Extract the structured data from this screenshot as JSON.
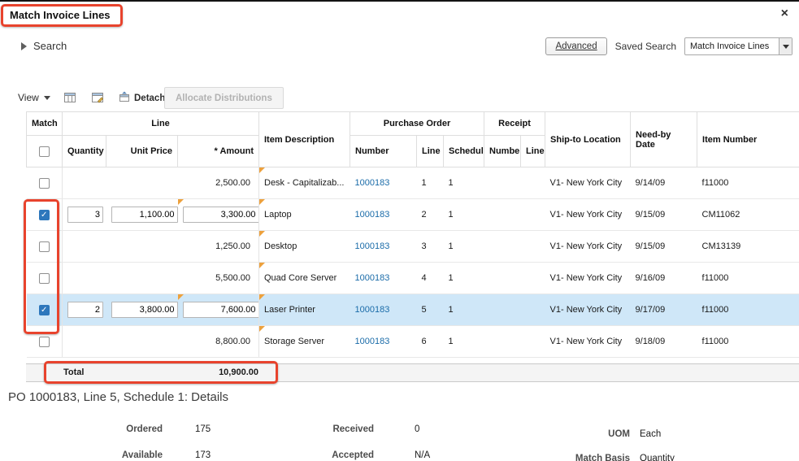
{
  "colors": {
    "annotation": "#e8432d",
    "link": "#1b6ca9",
    "selected_row": "#cfe7f8",
    "marker": "#eda13d",
    "checkbox": "#2d77bc"
  },
  "dialog": {
    "title": "Match Invoice Lines",
    "close_label": "×"
  },
  "search": {
    "label": "Search",
    "advanced_label": "Advanced",
    "saved_search_label": "Saved Search",
    "saved_search_value": "Match Invoice Lines"
  },
  "toolbar": {
    "view_label": "View",
    "detach_label": "Detach",
    "allocate_label": "Allocate Distributions"
  },
  "table": {
    "group_headers": {
      "match": "Match",
      "line": "Line",
      "item_description": "Item Description",
      "purchase_order": "Purchase Order",
      "receipt": "Receipt",
      "ship_to_location": "Ship-to Location",
      "need_by_date": "Need-by Date",
      "item_number": "Item Number"
    },
    "sub_headers": {
      "quantity": "Quantity",
      "unit_price": "Unit Price",
      "amount": "* Amount",
      "po_number": "Number",
      "po_line": "Line",
      "po_schedule": "Schedul",
      "receipt_number": "Numbe",
      "receipt_line": "Line"
    },
    "rows": [
      {
        "checked": false,
        "selected": false,
        "quantity": "",
        "unit_price": "",
        "amount": "2,500.00",
        "description": "Desk - Capitalizab...",
        "po_number": "1000183",
        "po_line": "1",
        "po_schedule": "1",
        "receipt_number": "",
        "receipt_line": "",
        "ship_to_location": "V1- New York City",
        "need_by_date": "9/14/09",
        "item_number": "f11000"
      },
      {
        "checked": true,
        "selected": false,
        "quantity": "3",
        "unit_price": "1,100.00",
        "amount": "3,300.00",
        "description": "Laptop",
        "po_number": "1000183",
        "po_line": "2",
        "po_schedule": "1",
        "receipt_number": "",
        "receipt_line": "",
        "ship_to_location": "V1- New York City",
        "need_by_date": "9/15/09",
        "item_number": "CM11062"
      },
      {
        "checked": false,
        "selected": false,
        "quantity": "",
        "unit_price": "",
        "amount": "1,250.00",
        "description": "Desktop",
        "po_number": "1000183",
        "po_line": "3",
        "po_schedule": "1",
        "receipt_number": "",
        "receipt_line": "",
        "ship_to_location": "V1- New York City",
        "need_by_date": "9/15/09",
        "item_number": "CM13139"
      },
      {
        "checked": false,
        "selected": false,
        "quantity": "",
        "unit_price": "",
        "amount": "5,500.00",
        "description": "Quad Core Server",
        "po_number": "1000183",
        "po_line": "4",
        "po_schedule": "1",
        "receipt_number": "",
        "receipt_line": "",
        "ship_to_location": "V1- New York City",
        "need_by_date": "9/16/09",
        "item_number": "f11000"
      },
      {
        "checked": true,
        "selected": true,
        "quantity": "2",
        "unit_price": "3,800.00",
        "amount": "7,600.00",
        "description": "Laser Printer",
        "po_number": "1000183",
        "po_line": "5",
        "po_schedule": "1",
        "receipt_number": "",
        "receipt_line": "",
        "ship_to_location": "V1- New York City",
        "need_by_date": "9/17/09",
        "item_number": "f11000"
      },
      {
        "checked": false,
        "selected": false,
        "quantity": "",
        "unit_price": "",
        "amount": "8,800.00",
        "description": "Storage Server",
        "po_number": "1000183",
        "po_line": "6",
        "po_schedule": "1",
        "receipt_number": "",
        "receipt_line": "",
        "ship_to_location": "V1- New York City",
        "need_by_date": "9/18/09",
        "item_number": "f11000"
      }
    ],
    "total_label": "Total",
    "total_value": "10,900.00"
  },
  "details": {
    "title": "PO 1000183, Line 5, Schedule 1: Details",
    "columns": [
      {
        "fields": [
          {
            "label": "Ordered",
            "value": "175"
          },
          {
            "label": "Available",
            "value": "173"
          }
        ]
      },
      {
        "fields": [
          {
            "label": "Received",
            "value": "0"
          },
          {
            "label": "Accepted",
            "value": "N/A"
          }
        ]
      },
      {
        "fields": [
          {
            "label": "UOM",
            "value": "Each"
          },
          {
            "label": "Match Basis",
            "value": "Quantity"
          }
        ]
      }
    ]
  }
}
